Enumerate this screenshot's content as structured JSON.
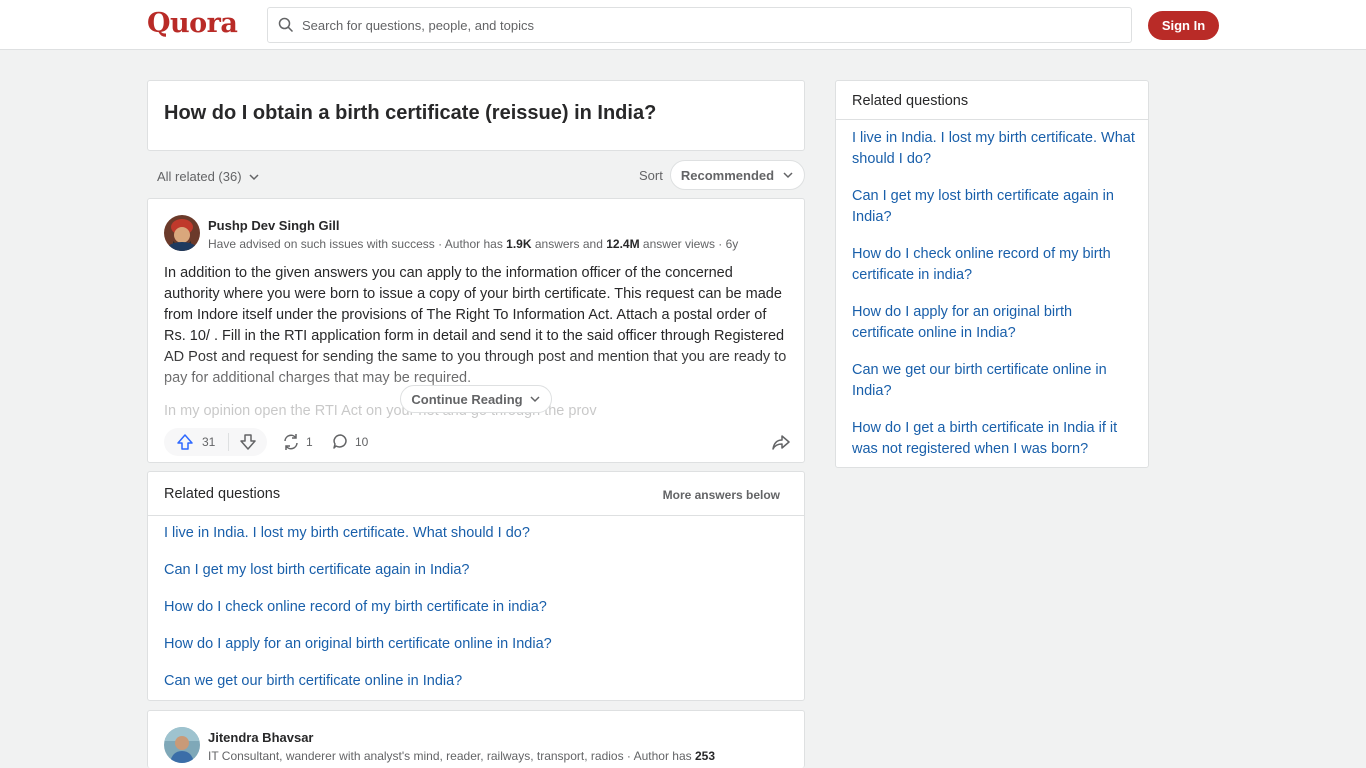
{
  "header": {
    "logo": "Quora",
    "search_placeholder": "Search for questions, people, and topics",
    "signin_label": "Sign In"
  },
  "question": {
    "title": "How do I obtain a birth certificate (reissue) in India?"
  },
  "filters": {
    "all_related": "All related (36)",
    "sort_label": "Sort",
    "sort_value": "Recommended"
  },
  "answer1": {
    "author": "Pushp Dev Singh Gill",
    "cred_prefix": "Have advised on such issues with success · Author has ",
    "answers_count": "1.9K",
    "cred_mid": " answers and ",
    "views_count": "12.4M",
    "cred_suffix": " answer views · 6y",
    "text": "In addition to the given answers you can apply to the information officer of the concerned authority where you were born to issue a copy of your birth certificate. This request can be made from Indore itself under the provisions of The Right To Information Act. Attach a postal order of Rs. 10/ . Fill in the RTI application form in detail and send it to the said officer through Registered AD Post and request for sending the same to you through post and mention that you are ready to pay for additional charges that may be required.",
    "text2": "In my opinion open the RTI Act on your net and go through the prov",
    "continue_label": "Continue Reading",
    "upvotes": "31",
    "shares": "1",
    "comments": "10"
  },
  "related_center": {
    "heading": "Related questions",
    "more_below": "More answers below",
    "items": [
      "I live in India. I lost my birth certificate. What should I do?",
      "Can I get my lost birth certificate again in India?",
      "How do I check online record of my birth certificate in india?",
      "How do I apply for an original birth certificate online in India?",
      "Can we get our birth certificate online in India?"
    ]
  },
  "answer2": {
    "author": "Jitendra Bhavsar",
    "cred_prefix": "IT Consultant, wanderer with analyst's mind, reader, railways, transport, radios · Author has ",
    "answers_count": "253"
  },
  "sidebar": {
    "heading": "Related questions",
    "items": [
      "I live in India. I lost my birth certificate. What should I do?",
      "Can I get my lost birth certificate again in India?",
      "How do I check online record of my birth certificate in india?",
      "How do I apply for an original birth certificate online in India?",
      "Can we get our birth certificate online in India?",
      "How do I get a birth certificate in India if it was not registered when I was born?"
    ]
  },
  "colors": {
    "brand": "#b92b27",
    "link": "#195faa",
    "background": "#f1f2f2"
  }
}
